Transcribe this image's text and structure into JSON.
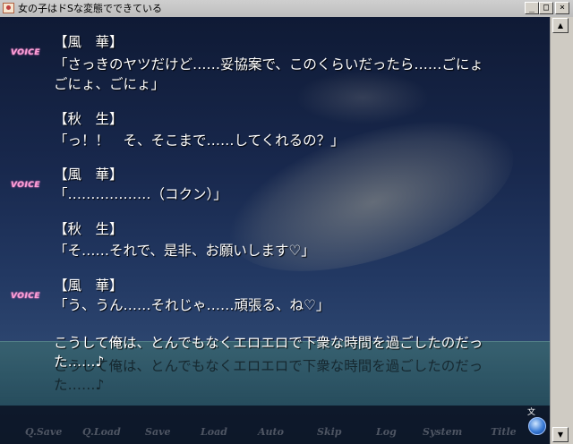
{
  "window": {
    "title": "女の子はドSな変態でできている",
    "buttons": [
      "_",
      "□",
      "×"
    ]
  },
  "dialogue": [
    {
      "voice": true,
      "speaker": "【風　華】",
      "lines": [
        "「さっきのヤツだけど……妥協案で、このくらいだったら……ごにょ",
        "ごにょ、ごにょ」"
      ]
    },
    {
      "voice": false,
      "speaker": "【秋　生】",
      "lines": [
        "「っ！！　そ、そこまで……してくれるの？」"
      ]
    },
    {
      "voice": true,
      "speaker": "【風　華】",
      "lines": [
        "「………………（コクン）」"
      ]
    },
    {
      "voice": false,
      "speaker": "【秋　生】",
      "lines": [
        "「そ……それで、是非、お願いします♡」"
      ]
    },
    {
      "voice": true,
      "speaker": "【風　華】",
      "lines": [
        "「う、うん……それじゃ……頑張る、ね♡」"
      ]
    },
    {
      "voice": false,
      "speaker": "",
      "lines": [
        "こうして俺は、とんでもなくエロエロで下衆な時間を過ごしたのだっ",
        "た……♪"
      ]
    }
  ],
  "voice_label": "VOICE",
  "menu": [
    "Q.Save",
    "Q.Load",
    "Save",
    "Load",
    "Auto",
    "Skip",
    "Log",
    "System",
    "Title"
  ],
  "page_mark": "文",
  "colors": {
    "text": "#ffffff",
    "voice": "#ff9fd8",
    "sky": "#18284d"
  }
}
